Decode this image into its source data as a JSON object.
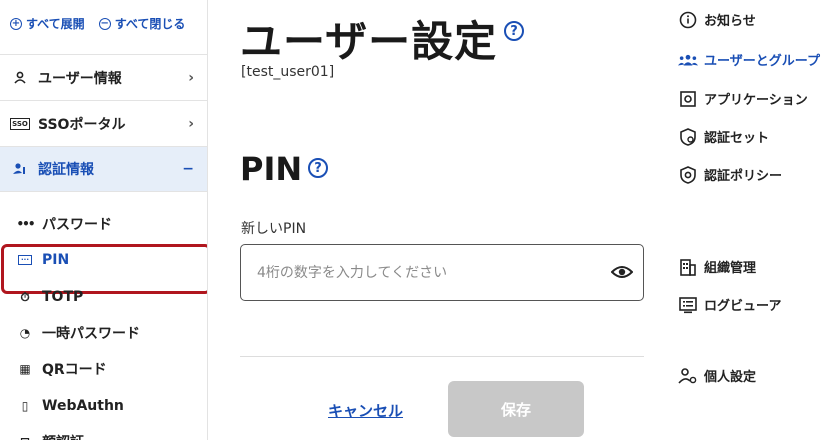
{
  "sidebar": {
    "expand_all": "すべて展開",
    "collapse_all": "すべて閉じる",
    "items": [
      {
        "label": "ユーザー情報",
        "icon": "person-icon"
      },
      {
        "label": "SSOポータル",
        "icon": "sso-icon",
        "icon_text": "SSO"
      },
      {
        "label": "認証情報",
        "icon": "person-key-icon"
      }
    ],
    "sub_items": [
      {
        "label": "パスワード",
        "icon": "password-dots-icon"
      },
      {
        "label": "PIN",
        "icon": "pin-box-icon"
      },
      {
        "label": "TOTP",
        "icon": "timer-icon"
      },
      {
        "label": "一時パスワード",
        "icon": "temp-password-icon"
      },
      {
        "label": "QRコード",
        "icon": "qr-code-icon"
      },
      {
        "label": "WebAuthn",
        "icon": "security-key-icon"
      },
      {
        "label": "顔認証",
        "icon": "face-icon"
      }
    ]
  },
  "main": {
    "title": "ユーザー設定",
    "user_id": "[test_user01]",
    "section_title": "PIN",
    "field_label": "新しいPIN",
    "input_placeholder": "4桁の数字を入力してください",
    "input_value": "",
    "cancel_label": "キャンセル",
    "save_label": "保存"
  },
  "right_nav": {
    "items": [
      {
        "label": "お知らせ",
        "icon": "info-icon"
      },
      {
        "label": "ユーザーとグループ",
        "icon": "users-group-icon"
      },
      {
        "label": "アプリケーション",
        "icon": "application-icon"
      },
      {
        "label": "認証セット",
        "icon": "shield-gear-icon"
      },
      {
        "label": "認証ポリシー",
        "icon": "shield-lock-icon"
      },
      {
        "label": "組織管理",
        "icon": "building-icon"
      },
      {
        "label": "ログビューア",
        "icon": "log-viewer-icon"
      },
      {
        "label": "個人設定",
        "icon": "person-gear-icon"
      }
    ]
  },
  "colors": {
    "accent": "#1a4fb5",
    "highlight_border": "#b0161e",
    "active_bg": "#e6eef9",
    "save_disabled": "#c8c8c8"
  }
}
